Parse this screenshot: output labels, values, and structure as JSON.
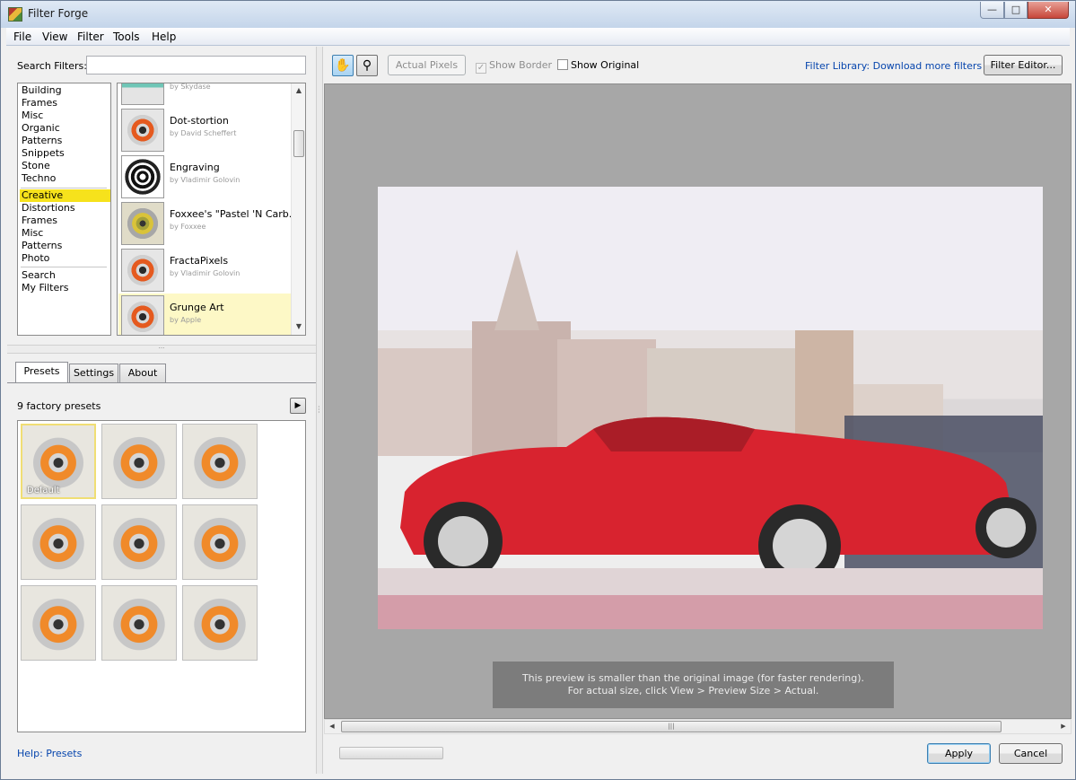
{
  "window": {
    "title": "Filter Forge"
  },
  "menubar": {
    "items": [
      "File",
      "View",
      "Filter",
      "Tools",
      "Help"
    ]
  },
  "search": {
    "label": "Search Filters:",
    "value": ""
  },
  "categories": {
    "group1": [
      "Building",
      "Frames",
      "Misc",
      "Organic",
      "Patterns",
      "Snippets",
      "Stone",
      "Techno"
    ],
    "group2": [
      "Creative",
      "Distortions",
      "Frames",
      "Misc",
      "Patterns",
      "Photo"
    ],
    "group3": [
      "Search",
      "My Filters"
    ],
    "selected": "Creative"
  },
  "filters": [
    {
      "name": "",
      "author": "by Skydase",
      "thumb": "cut"
    },
    {
      "name": "Dot-stortion",
      "author": "by David Scheffert",
      "thumb": "ring"
    },
    {
      "name": "Engraving",
      "author": "by Vladimir Golovin",
      "thumb": "bw"
    },
    {
      "name": "Foxxee's \"Pastel 'N Carb...",
      "author": "by Foxxee",
      "thumb": "gold"
    },
    {
      "name": "FractaPixels",
      "author": "by Vladimir Golovin",
      "thumb": "ring"
    },
    {
      "name": "Grunge Art",
      "author": "by Apple",
      "thumb": "ring",
      "selected": true
    }
  ],
  "tabs": [
    {
      "label": "Presets",
      "active": true
    },
    {
      "label": "Settings",
      "active": false
    },
    {
      "label": "About",
      "active": false
    }
  ],
  "presets": {
    "count_label": "9 factory presets",
    "default_label": "Default",
    "count": 9
  },
  "help": {
    "presets_link": "Help: Presets"
  },
  "toolbar": {
    "actual_pixels": "Actual Pixels",
    "show_border": "Show Border",
    "show_border_checked": true,
    "show_original": "Show Original",
    "show_original_checked": false,
    "library_link": "Filter Library: Download more filters",
    "filter_editor": "Filter Editor..."
  },
  "preview": {
    "note_line1": "This preview is smaller than the original image (for faster rendering).",
    "note_line2": "For actual size, click View > Preview Size > Actual."
  },
  "render_progress": 0.0,
  "buttons": {
    "apply": "Apply",
    "cancel": "Cancel"
  },
  "colors": {
    "selection": "#f6e21c",
    "link": "#0645ad",
    "preview_bg": "#a7a7a7"
  }
}
